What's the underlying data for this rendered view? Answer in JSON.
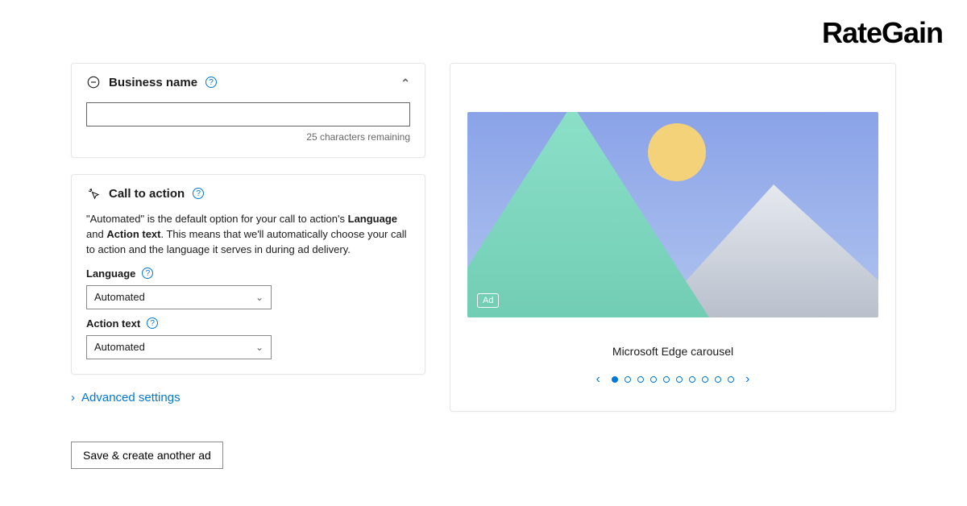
{
  "brand": "RateGain",
  "business_name": {
    "title": "Business name",
    "value": "",
    "char_remaining": "25 characters remaining"
  },
  "cta": {
    "title": "Call to action",
    "desc_pre": "\"Automated\" is the default option for your call to action's ",
    "desc_bold1": "Language",
    "desc_mid": " and ",
    "desc_bold2": "Action text",
    "desc_post": ". This means that we'll automatically choose your call to action and the language it serves in during ad delivery.",
    "language_label": "Language",
    "language_value": "Automated",
    "action_label": "Action text",
    "action_value": "Automated"
  },
  "advanced_link": "Advanced settings",
  "save_button": "Save & create another ad",
  "preview": {
    "ad_badge": "Ad",
    "caption": "Microsoft Edge carousel",
    "dots_total": 10,
    "dots_active": 0
  }
}
